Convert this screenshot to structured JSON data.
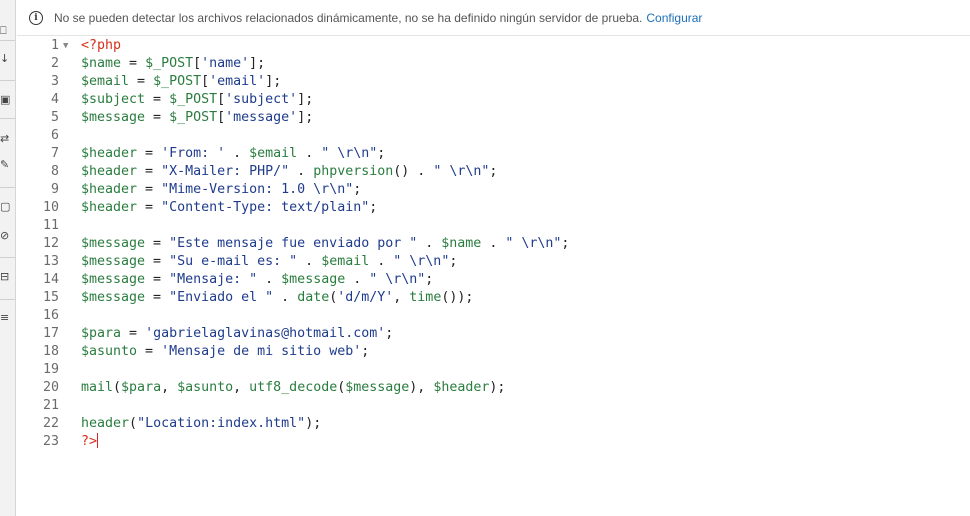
{
  "infobar": {
    "message": "No se pueden detectar los archivos relacionados dinámicamente, no se ha definido ningún servidor de prueba.",
    "link": "Configurar"
  },
  "toolbar": {
    "tools": [
      {
        "name": "tool-file-icon",
        "glyph": "⎕"
      },
      {
        "name": "tool-download-icon",
        "glyph": "↓"
      },
      {
        "name": "tool-code-icon",
        "glyph": "▣"
      },
      {
        "name": "tool-transform-icon",
        "glyph": "⇄"
      },
      {
        "name": "tool-brush-icon",
        "glyph": "✎"
      },
      {
        "name": "tool-box-icon",
        "glyph": "▢"
      },
      {
        "name": "tool-clear-icon",
        "glyph": "⊘"
      },
      {
        "name": "tool-tree-icon",
        "glyph": "⊟"
      },
      {
        "name": "tool-list-icon",
        "glyph": "≡"
      }
    ]
  },
  "editor": {
    "lines": [
      {
        "n": "1",
        "fold": "▼",
        "tokens": [
          [
            "tag",
            "<?php"
          ]
        ]
      },
      {
        "n": "2",
        "tokens": [
          [
            "var",
            "$name"
          ],
          [
            "op",
            " = "
          ],
          [
            "var",
            "$_POST"
          ],
          [
            "punc",
            "["
          ],
          [
            "str",
            "'name'"
          ],
          [
            "punc",
            "];"
          ]
        ]
      },
      {
        "n": "3",
        "tokens": [
          [
            "var",
            "$email"
          ],
          [
            "op",
            " = "
          ],
          [
            "var",
            "$_POST"
          ],
          [
            "punc",
            "["
          ],
          [
            "str",
            "'email'"
          ],
          [
            "punc",
            "];"
          ]
        ]
      },
      {
        "n": "4",
        "tokens": [
          [
            "var",
            "$subject"
          ],
          [
            "op",
            " = "
          ],
          [
            "var",
            "$_POST"
          ],
          [
            "punc",
            "["
          ],
          [
            "str",
            "'subject'"
          ],
          [
            "punc",
            "];"
          ]
        ]
      },
      {
        "n": "5",
        "tokens": [
          [
            "var",
            "$message"
          ],
          [
            "op",
            " = "
          ],
          [
            "var",
            "$_POST"
          ],
          [
            "punc",
            "["
          ],
          [
            "str",
            "'message'"
          ],
          [
            "punc",
            "];"
          ]
        ]
      },
      {
        "n": "6",
        "tokens": []
      },
      {
        "n": "7",
        "tokens": [
          [
            "var",
            "$header"
          ],
          [
            "op",
            " = "
          ],
          [
            "str",
            "'From: '"
          ],
          [
            "op",
            " . "
          ],
          [
            "var",
            "$email"
          ],
          [
            "op",
            " . "
          ],
          [
            "str",
            "\" \\r\\n\""
          ],
          [
            "punc",
            ";"
          ]
        ]
      },
      {
        "n": "8",
        "tokens": [
          [
            "var",
            "$header"
          ],
          [
            "op",
            " = "
          ],
          [
            "str",
            "\"X-Mailer: PHP/\""
          ],
          [
            "op",
            " . "
          ],
          [
            "fn",
            "phpversion"
          ],
          [
            "punc",
            "()"
          ],
          [
            "op",
            " . "
          ],
          [
            "str",
            "\" \\r\\n\""
          ],
          [
            "punc",
            ";"
          ]
        ]
      },
      {
        "n": "9",
        "tokens": [
          [
            "var",
            "$header"
          ],
          [
            "op",
            " = "
          ],
          [
            "str",
            "\"Mime-Version: 1.0 \\r\\n\""
          ],
          [
            "punc",
            ";"
          ]
        ]
      },
      {
        "n": "10",
        "tokens": [
          [
            "var",
            "$header"
          ],
          [
            "op",
            " = "
          ],
          [
            "str",
            "\"Content-Type: text/plain\""
          ],
          [
            "punc",
            ";"
          ]
        ]
      },
      {
        "n": "11",
        "tokens": []
      },
      {
        "n": "12",
        "tokens": [
          [
            "var",
            "$message"
          ],
          [
            "op",
            " = "
          ],
          [
            "str",
            "\"Este mensaje fue enviado por \""
          ],
          [
            "op",
            " . "
          ],
          [
            "var",
            "$name"
          ],
          [
            "op",
            " . "
          ],
          [
            "str",
            "\" \\r\\n\""
          ],
          [
            "punc",
            ";"
          ]
        ]
      },
      {
        "n": "13",
        "tokens": [
          [
            "var",
            "$message"
          ],
          [
            "op",
            " = "
          ],
          [
            "str",
            "\"Su e-mail es: \""
          ],
          [
            "op",
            " . "
          ],
          [
            "var",
            "$email"
          ],
          [
            "op",
            " . "
          ],
          [
            "str",
            "\" \\r\\n\""
          ],
          [
            "punc",
            ";"
          ]
        ]
      },
      {
        "n": "14",
        "tokens": [
          [
            "var",
            "$message"
          ],
          [
            "op",
            " = "
          ],
          [
            "str",
            "\"Mensaje: \""
          ],
          [
            "op",
            " . "
          ],
          [
            "var",
            "$message"
          ],
          [
            "op",
            " . "
          ],
          [
            "str",
            "\" \\r\\n\""
          ],
          [
            "punc",
            ";"
          ]
        ]
      },
      {
        "n": "15",
        "tokens": [
          [
            "var",
            "$message"
          ],
          [
            "op",
            " = "
          ],
          [
            "str",
            "\"Enviado el \""
          ],
          [
            "op",
            " . "
          ],
          [
            "fn",
            "date"
          ],
          [
            "punc",
            "("
          ],
          [
            "str",
            "'d/m/Y'"
          ],
          [
            "punc",
            ", "
          ],
          [
            "fn",
            "time"
          ],
          [
            "punc",
            "());"
          ]
        ]
      },
      {
        "n": "16",
        "tokens": []
      },
      {
        "n": "17",
        "tokens": [
          [
            "var",
            "$para"
          ],
          [
            "op",
            " = "
          ],
          [
            "str",
            "'gabrielaglavinas@hotmail.com'"
          ],
          [
            "punc",
            ";"
          ]
        ]
      },
      {
        "n": "18",
        "tokens": [
          [
            "var",
            "$asunto"
          ],
          [
            "op",
            " = "
          ],
          [
            "str",
            "'Mensaje de mi sitio web'"
          ],
          [
            "punc",
            ";"
          ]
        ]
      },
      {
        "n": "19",
        "tokens": []
      },
      {
        "n": "20",
        "tokens": [
          [
            "fn",
            "mail"
          ],
          [
            "punc",
            "("
          ],
          [
            "var",
            "$para"
          ],
          [
            "punc",
            ", "
          ],
          [
            "var",
            "$asunto"
          ],
          [
            "punc",
            ", "
          ],
          [
            "fn",
            "utf8_decode"
          ],
          [
            "punc",
            "("
          ],
          [
            "var",
            "$message"
          ],
          [
            "punc",
            "), "
          ],
          [
            "var",
            "$header"
          ],
          [
            "punc",
            ");"
          ]
        ]
      },
      {
        "n": "21",
        "tokens": []
      },
      {
        "n": "22",
        "tokens": [
          [
            "fn",
            "header"
          ],
          [
            "punc",
            "("
          ],
          [
            "str",
            "\"Location:index.html\""
          ],
          [
            "punc",
            ");"
          ]
        ]
      },
      {
        "n": "23",
        "tokens": [
          [
            "tag",
            "?>"
          ]
        ],
        "caret": true
      }
    ]
  }
}
